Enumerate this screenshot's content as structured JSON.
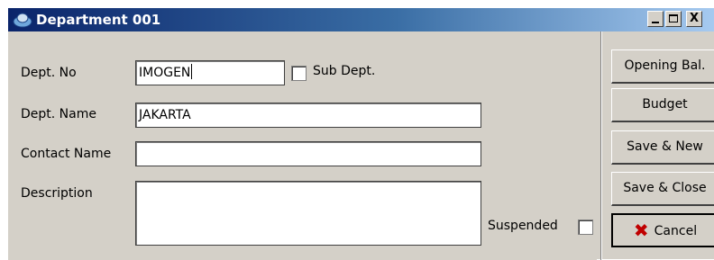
{
  "window": {
    "title": "Department 001",
    "controls": {
      "minimize": "_",
      "maximize": "□",
      "close": "X"
    }
  },
  "form": {
    "dept_no": {
      "label": "Dept. No",
      "value": "IMOGEN"
    },
    "sub_dept": {
      "label": "Sub Dept.",
      "checked": false
    },
    "dept_name": {
      "label": "Dept. Name",
      "value": "JAKARTA"
    },
    "contact_name": {
      "label": "Contact Name",
      "value": ""
    },
    "description": {
      "label": "Description",
      "value": ""
    },
    "suspended": {
      "label": "Suspended",
      "checked": false
    }
  },
  "buttons": {
    "opening_bal": "Opening Bal.",
    "budget": "Budget",
    "save_new": "Save & New",
    "save_close": "Save & Close",
    "cancel": "Cancel"
  },
  "icons": {
    "window": "app-cloud-icon",
    "cancel": "red-x-icon"
  },
  "colors": {
    "titlebar_start": "#0a246a",
    "titlebar_end": "#a6caf0",
    "face": "#d4d0c8",
    "cancel_x": "#c00000"
  }
}
